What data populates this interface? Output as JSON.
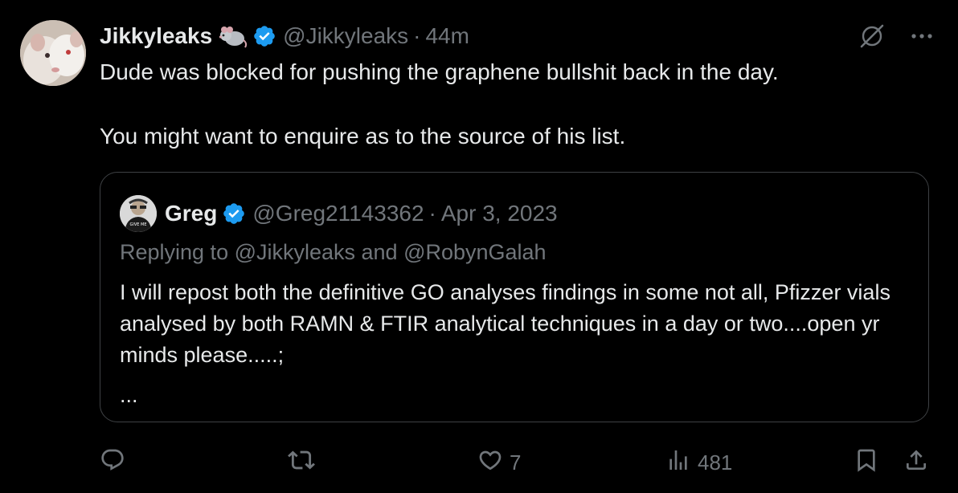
{
  "tweet": {
    "author": {
      "display_name": "Jikkyleaks",
      "emoji_icon": "rat-emoji-icon",
      "handle": "@Jikkyleaks",
      "verified": true
    },
    "separator": "·",
    "time": "44m",
    "paragraphs": [
      "Dude was blocked for pushing the graphene bullshit back in the day.",
      "You might want to enquire as to the source of his list."
    ]
  },
  "quote": {
    "author": {
      "display_name": "Greg",
      "handle": "@Greg21143362",
      "verified": true
    },
    "separator": "·",
    "date": "Apr 3, 2023",
    "replying_to": "Replying to @Jikkyleaks and @RobynGalah",
    "body": "I will repost both the definitive GO analyses findings in some not all, Pfizzer vials analysed by both RAMN & FTIR analytical techniques in a day or two....open yr minds please.....;",
    "more": "..."
  },
  "actions": {
    "reply_count": "",
    "repost_count": "",
    "like_count": "7",
    "views_count": "481"
  },
  "colors": {
    "background": "#000000",
    "text": "#e7e9ea",
    "muted": "#71767b",
    "verified_blue": "#1d9bf0",
    "border": "#3e4144"
  }
}
